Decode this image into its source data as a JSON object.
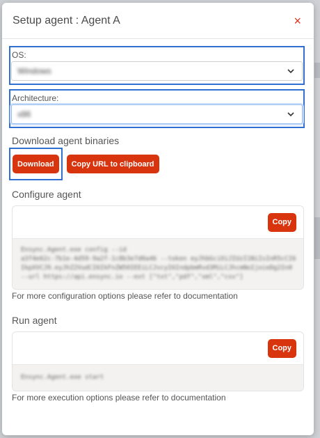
{
  "modal": {
    "title": "Setup agent : Agent A",
    "close_glyph": "×"
  },
  "os": {
    "label": "OS:",
    "value": "Windows"
  },
  "architecture": {
    "label": "Architecture:",
    "value": "x86"
  },
  "download": {
    "title": "Download agent binaries",
    "download_label": "Download",
    "copy_url_label": "Copy URL to clipboard"
  },
  "configure": {
    "title": "Configure agent",
    "copy_label": "Copy",
    "code_lines": [
      "Ensync.Agent.exe config --id",
      "a3f4e62c-7b1e-4d59-9a2f-1c8b3e7d0a46 --token eyJhbGciOiJIUzI1NiIsInR5cCI6",
      "IkpXVCJ9.eyJhZ2VudCI6IkFnZW50IEEiLCJvcyI6IndpbmRvd3MiLCJhcmNoIjoieDg2In0",
      "--url https://api.ensync.io --ext [\"txt\",\"pdf\",\"xml\",\"csv\"]"
    ],
    "note": "For more configuration options please refer to documentation"
  },
  "run": {
    "title": "Run agent",
    "copy_label": "Copy",
    "code_lines": [
      "Ensync.Agent.exe start"
    ],
    "note": "For more execution options please refer to documentation"
  },
  "colors": {
    "accent": "#d8340e",
    "focus_outline": "#2f6fd1",
    "close": "#e2311d"
  }
}
